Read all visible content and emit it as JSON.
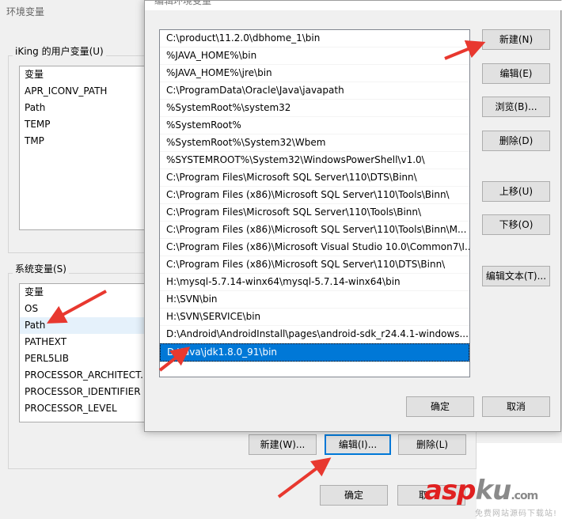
{
  "env_window": {
    "title": "环境变量",
    "user_group_label": "iKing 的用户变量(U)",
    "user_vars_header": "变量",
    "user_vars": [
      "APR_ICONV_PATH",
      "Path",
      "TEMP",
      "TMP"
    ],
    "sys_group_label": "系统变量(S)",
    "sys_vars_header": "变量",
    "sys_vars": [
      "OS",
      "Path",
      "PATHEXT",
      "PERL5LIB",
      "PROCESSOR_ARCHITECT...",
      "PROCESSOR_IDENTIFIER",
      "PROCESSOR_LEVEL"
    ],
    "sys_buttons": {
      "new": "新建(W)...",
      "edit": "编辑(I)...",
      "delete": "删除(L)"
    },
    "ok": "确定",
    "cancel_partial": "取"
  },
  "edit_dialog": {
    "title": "编辑环境变量",
    "paths": [
      "C:\\product\\11.2.0\\dbhome_1\\bin",
      "%JAVA_HOME%\\bin",
      "%JAVA_HOME%\\jre\\bin",
      "C:\\ProgramData\\Oracle\\Java\\javapath",
      "%SystemRoot%\\system32",
      "%SystemRoot%",
      "%SystemRoot%\\System32\\Wbem",
      "%SYSTEMROOT%\\System32\\WindowsPowerShell\\v1.0\\",
      "C:\\Program Files\\Microsoft SQL Server\\110\\DTS\\Binn\\",
      "C:\\Program Files (x86)\\Microsoft SQL Server\\110\\Tools\\Binn\\",
      "C:\\Program Files\\Microsoft SQL Server\\110\\Tools\\Binn\\",
      "C:\\Program Files (x86)\\Microsoft SQL Server\\110\\Tools\\Binn\\M...",
      "C:\\Program Files (x86)\\Microsoft Visual Studio 10.0\\Common7\\I...",
      "C:\\Program Files (x86)\\Microsoft SQL Server\\110\\DTS\\Binn\\",
      "H:\\mysql-5.7.14-winx64\\mysql-5.7.14-winx64\\bin",
      "H:\\SVN\\bin",
      "H:\\SVN\\SERVICE\\bin",
      "D:\\Android\\AndroidInstall\\pages\\android-sdk_r24.4.1-windows...",
      "D:\\Java\\jdk1.8.0_91\\bin"
    ],
    "selected_index": 18,
    "buttons": {
      "new": "新建(N)",
      "edit": "编辑(E)",
      "browse": "浏览(B)...",
      "delete": "删除(D)",
      "move_up": "上移(U)",
      "move_down": "下移(O)",
      "edit_text": "编辑文本(T)..."
    },
    "ok": "确定",
    "cancel": "取消"
  },
  "watermark": {
    "brand_a": "asp",
    "brand_b": "ku",
    "brand_suffix": ".com",
    "subtitle": "免费网站源码下载站!"
  },
  "colors": {
    "selection": "#0078d7",
    "arrow": "#e8382f"
  }
}
